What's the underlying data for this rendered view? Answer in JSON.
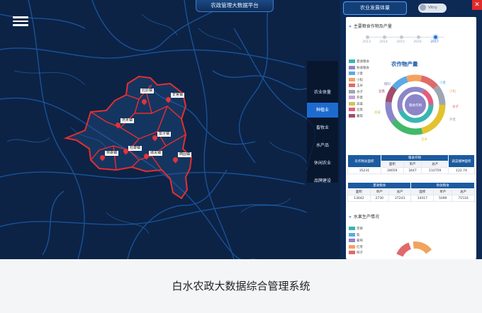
{
  "app": {
    "top_title": "农政管理大数据平台",
    "caption": "白水农政大数据综合管理系统"
  },
  "map": {
    "towns": [
      {
        "label": "北原镇"
      },
      {
        "label": "史官镇"
      },
      {
        "label": "尧禾镇"
      },
      {
        "label": "雷牙镇"
      },
      {
        "label": "林皋镇"
      },
      {
        "label": "杜康镇"
      },
      {
        "label": "城关镇"
      },
      {
        "label": "西固镇"
      }
    ]
  },
  "sidebar": {
    "items": [
      {
        "label": "农业体量",
        "active": false
      },
      {
        "label": "种植业",
        "active": true
      },
      {
        "label": "畜牧业",
        "active": false
      },
      {
        "label": "水产品",
        "active": false
      },
      {
        "label": "休闲农业",
        "active": false
      },
      {
        "label": "品牌建设",
        "active": false
      }
    ]
  },
  "panel": {
    "tab_label": "农业发展体量",
    "user_name": "Vitry",
    "close_glyph": "✕",
    "section1_title": "主要粮食作物及产量",
    "section2_title": "水果生产情况",
    "timeline": {
      "years": [
        "2013",
        "2014",
        "2015",
        "2016",
        "2017"
      ],
      "active_index": 4
    },
    "legend1": [
      {
        "label": "夏收粮食",
        "color": "#38b6b2"
      },
      {
        "label": "秋收粮食",
        "color": "#8c86c9"
      },
      {
        "label": "小麦",
        "color": "#5aaae6"
      },
      {
        "label": "小稻",
        "color": "#f2a35e"
      },
      {
        "label": "玉米",
        "color": "#e06a6a"
      },
      {
        "label": "谷子",
        "color": "#9ea6b2"
      },
      {
        "label": "荞麦",
        "color": "#c8a2d6"
      },
      {
        "label": "高粱",
        "color": "#c6c85a"
      },
      {
        "label": "豆类",
        "color": "#e35d7c"
      },
      {
        "label": "薯类",
        "color": "#a14c6c"
      }
    ],
    "donut": {
      "title": "农作物产量",
      "center_label": "粮食作物",
      "outer_labels": [
        "糖料",
        "豆类",
        "小麦",
        "小稻",
        "谷子",
        "荞麦",
        "高粱",
        "玉米"
      ],
      "outer_colors": [
        "#8c86c9",
        "#a14c6c",
        "#5aaae6",
        "#f2a35e",
        "#e06a6a",
        "#9ea6b2",
        "#c6c85a",
        "#e2c32e",
        "#42b86a",
        "#38b6b2"
      ],
      "inner_colors": [
        "#38b6b2",
        "#8c86c9",
        "#e35d7c"
      ]
    },
    "table1": {
      "headers": [
        "农作物总面积",
        "粮食作物",
        "蔬菜播种面积"
      ],
      "sub_headers": [
        "面积",
        "单产",
        "总产"
      ],
      "row": [
        "35231",
        "28059",
        "3447",
        "110759",
        "122.74"
      ]
    },
    "table2": {
      "headers": [
        "夏收粮食",
        "秋收粮食"
      ],
      "sub_headers": [
        "面积",
        "单产",
        "总产",
        "面积",
        "单产",
        "总产"
      ],
      "row": [
        "13642",
        "2730",
        "37243",
        "14417",
        "5099",
        "71516"
      ]
    },
    "legend2": [
      {
        "label": "苹果",
        "color": "#38b6b2"
      },
      {
        "label": "梨",
        "color": "#5aaae6"
      },
      {
        "label": "葡萄",
        "color": "#8c86c9"
      },
      {
        "label": "红枣",
        "color": "#f2a35e"
      },
      {
        "label": "柿子",
        "color": "#e06a6a"
      }
    ]
  }
}
